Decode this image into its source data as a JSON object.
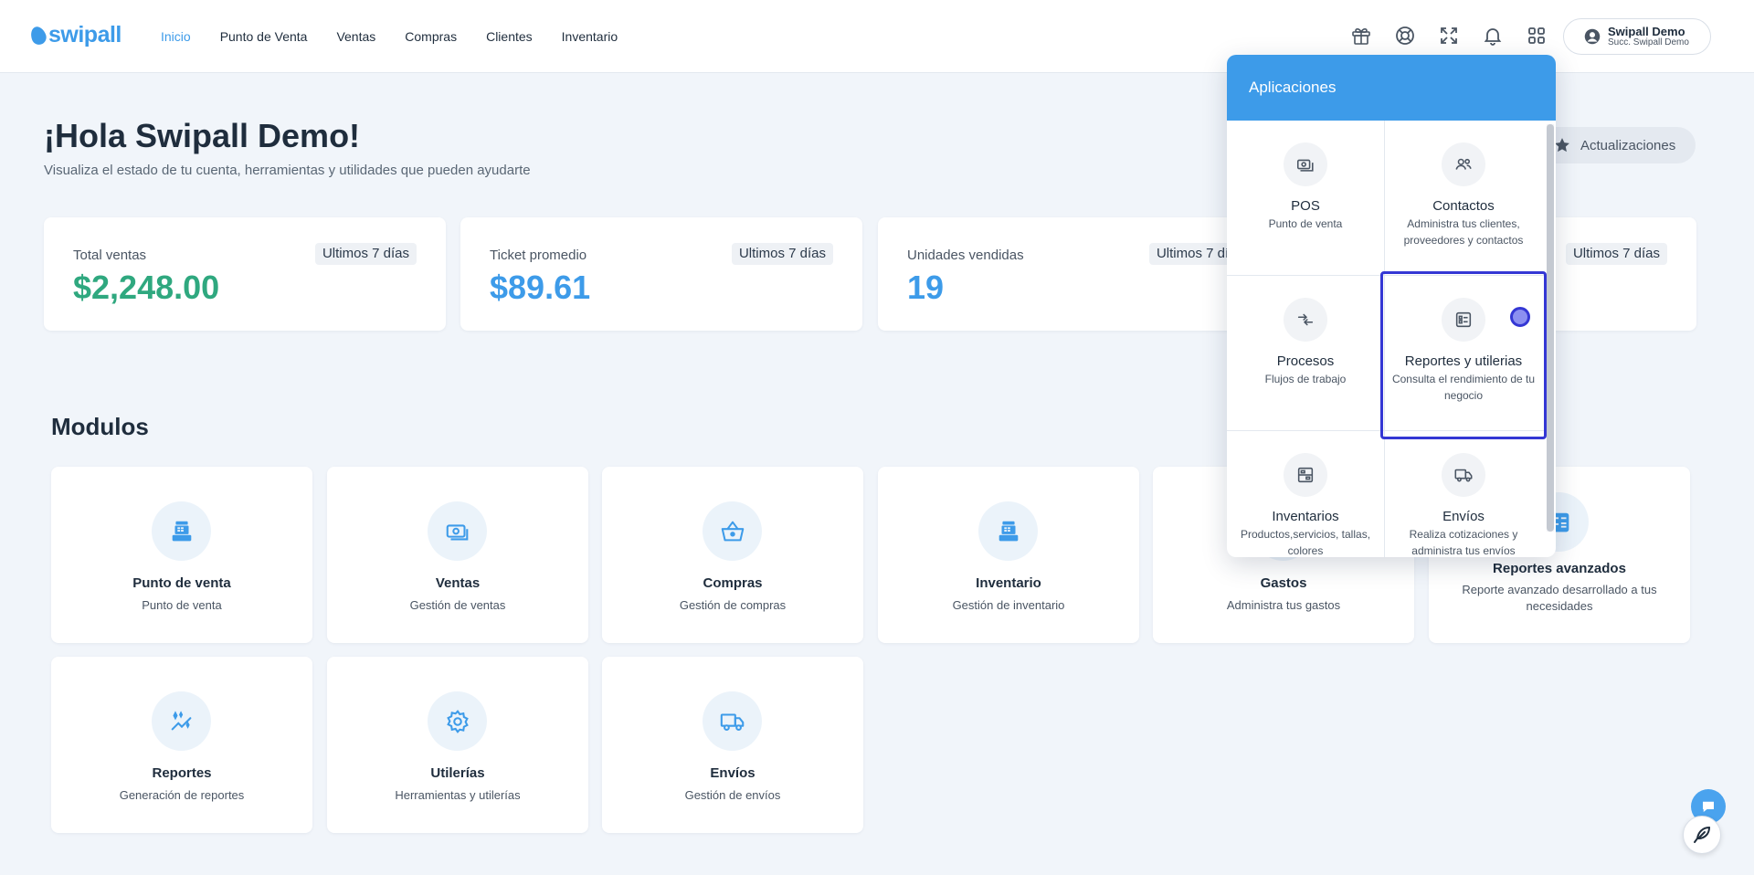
{
  "brand": {
    "name": "swipall",
    "color": "#3d9be9"
  },
  "nav": {
    "items": [
      {
        "label": "Inicio",
        "active": true
      },
      {
        "label": "Punto de Venta"
      },
      {
        "label": "Ventas"
      },
      {
        "label": "Compras"
      },
      {
        "label": "Clientes"
      },
      {
        "label": "Inventario"
      }
    ]
  },
  "header_icons": [
    "gift-icon",
    "help-circle-icon",
    "fullscreen-icon",
    "bell-icon",
    "apps-grid-icon"
  ],
  "user": {
    "name": "Swipall Demo",
    "branch": "Succ. Swipall Demo"
  },
  "greeting": {
    "title": "¡Hola Swipall Demo!",
    "subtitle": "Visualiza el estado de tu cuenta, herramientas y utilidades que pueden ayudarte"
  },
  "updates_button": {
    "label": "Actualizaciones",
    "icon": "star-icon"
  },
  "stats": [
    {
      "label": "Total ventas",
      "value": "$2,248.00",
      "period": "Ultimos 7 días",
      "color": "#2fa87f"
    },
    {
      "label": "Ticket promedio",
      "value": "$89.61",
      "period": "Ultimos 7 días",
      "color": "#3d9be9"
    },
    {
      "label": "Unidades vendidas",
      "value": "19",
      "period": "Ultimos 7 días",
      "color": "#3d9be9"
    },
    {
      "label": "",
      "value": "",
      "period": "Ultimos 7 días",
      "color": "#3d9be9"
    }
  ],
  "modules": {
    "title": "Modulos",
    "items": [
      {
        "name": "Punto de venta",
        "desc": "Punto de venta",
        "icon": "cash-register-icon"
      },
      {
        "name": "Ventas",
        "desc": "Gestión de ventas",
        "icon": "money-icon"
      },
      {
        "name": "Compras",
        "desc": "Gestión de compras",
        "icon": "basket-icon"
      },
      {
        "name": "Inventario",
        "desc": "Gestión de inventario",
        "icon": "cash-register-icon"
      },
      {
        "name": "Gastos",
        "desc": "Administra tus gastos",
        "icon": "wallet-icon"
      },
      {
        "name": "Reportes avanzados",
        "desc": "Reporte avanzado desarrollado a tus necesidades",
        "icon": "calculator-icon"
      },
      {
        "name": "Reportes",
        "desc": "Generación de reportes",
        "icon": "trend-chart-icon"
      },
      {
        "name": "Utilerías",
        "desc": "Herramientas y utilerías",
        "icon": "gear-icon"
      },
      {
        "name": "Envíos",
        "desc": "Gestión de envíos",
        "icon": "truck-icon"
      }
    ]
  },
  "apps_panel": {
    "title": "Aplicaciones",
    "items": [
      {
        "name": "POS",
        "desc": "Punto de venta",
        "icon": "money-icon"
      },
      {
        "name": "Contactos",
        "desc": "Administra tus clientes, proveedores y contactos",
        "icon": "people-icon"
      },
      {
        "name": "Procesos",
        "desc": "Flujos de trabajo",
        "icon": "arrows-icon"
      },
      {
        "name": "Reportes y utilerias",
        "desc": "Consulta el rendimiento de tu negocio",
        "icon": "report-icon",
        "selected": true
      },
      {
        "name": "Inventarios",
        "desc": "Productos,servicios, tallas, colores",
        "icon": "inventory-icon"
      },
      {
        "name": "Envíos",
        "desc": "Realiza cotizaciones y administra tus envíos",
        "icon": "truck-icon"
      }
    ]
  }
}
